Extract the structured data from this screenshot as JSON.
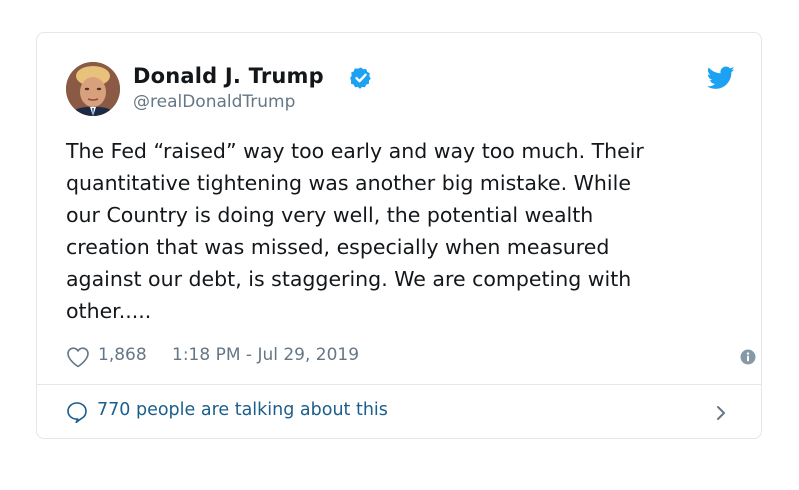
{
  "tweet": {
    "author_name": "Donald J. Trump",
    "handle": "@realDonaldTrump",
    "text_lines": [
      "The Fed “raised” way too early and way too much. Their",
      "quantitative tightening was another big mistake. While",
      "our Country is doing very well, the potential wealth",
      "creation that was missed, especially when measured",
      "against our debt, is staggering. We are competing with",
      "other....."
    ],
    "like_count": "1,868",
    "timestamp": "1:18 PM - Jul 29, 2019",
    "talking": "770 people are talking about this"
  },
  "icons": {
    "verified": "verified-badge-icon",
    "brand": "twitter-bird-icon",
    "like": "heart-icon",
    "info": "info-icon",
    "reply": "speech-bubble-icon",
    "more": "chevron-right-icon"
  },
  "colors": {
    "verified_blue": "#1da1f2",
    "bird_blue": "#1da1f2",
    "link_blue": "#1b5e8c",
    "secondary_text": "#657786",
    "border": "#e1e8ed"
  }
}
